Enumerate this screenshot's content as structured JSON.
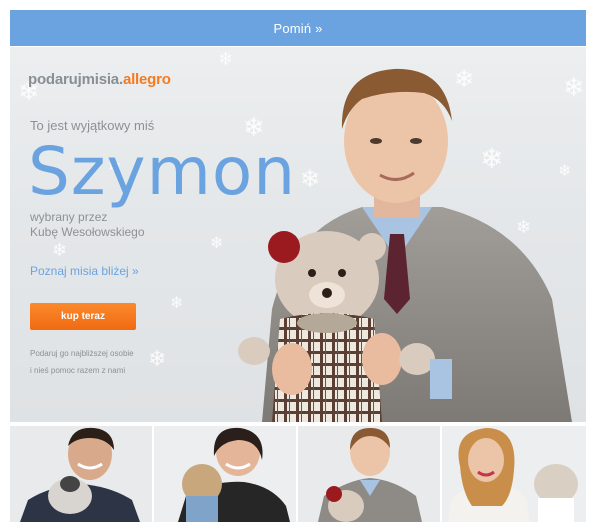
{
  "skip": {
    "label": "Pomiń »"
  },
  "logo": {
    "part1": "podarujmisia.",
    "part2": "allegro"
  },
  "hero": {
    "lead": "To jest wyjątkowy miś",
    "name": "Szymon",
    "chosen_line1": "wybrany przez",
    "chosen_line2": "Kubę Wesołowskiego",
    "more_link": "Poznaj misia bliżej »",
    "buy_button": "kup teraz",
    "gift_line1": "Podaruj go najbliższej osobie",
    "gift_line2": "i nieś pomoc razem z nami"
  },
  "colors": {
    "skip_bar": "#6aa3e0",
    "name_blue": "#6aa3e0",
    "brand_orange": "#f47b20",
    "button_orange": "#f06a12",
    "gray_text": "#8c9196"
  }
}
